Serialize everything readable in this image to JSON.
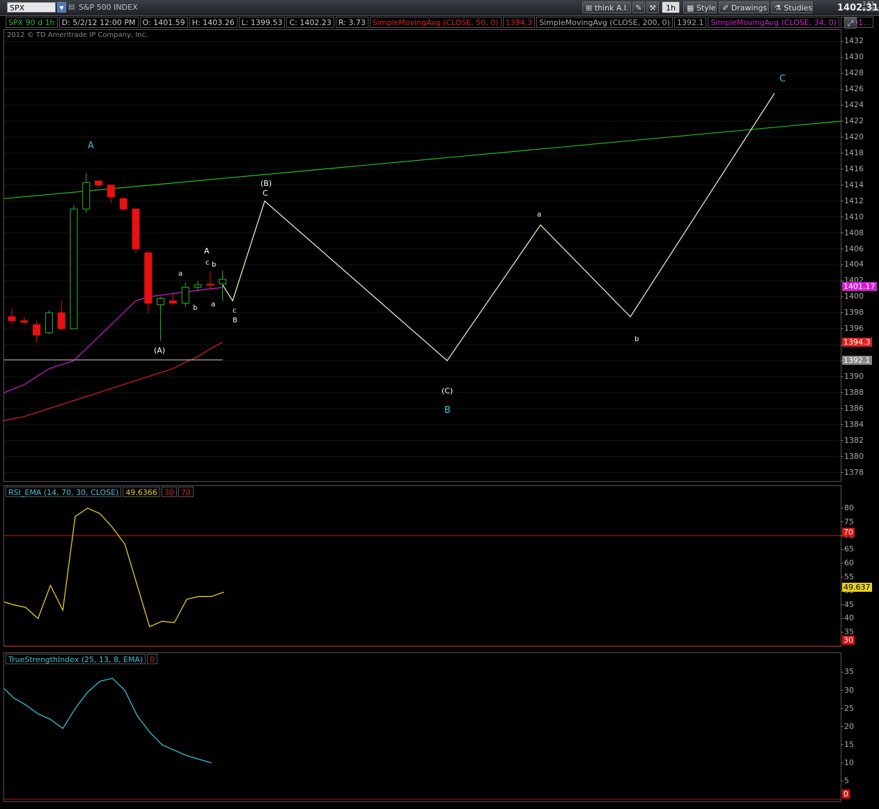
{
  "toolbar": {
    "symbol": "SPX",
    "symbol_name": "S&P 500 INDEX",
    "think_label": "think A.I.",
    "interval": "1h",
    "style_label": "Style",
    "drawings_label": "Drawings",
    "studies_label": "Studies",
    "last_price": "1402.31",
    "change": "-3.51",
    "change_pct": "-0.25%"
  },
  "header": {
    "chart_id": "SPX 90 d 1h",
    "date": "D: 5/2/12 12:00 PM",
    "open": "O: 1401.59",
    "high": "H: 1403.26",
    "low": "L: 1399.53",
    "close": "C: 1402.23",
    "range": "R: 3.73",
    "sma50_label": "SimpleMovingAvg (CLOSE, 50, 0)",
    "sma50_value": "1394.3",
    "sma200_label": "SimpleMovingAvg (CLOSE, 200, 0)",
    "sma200_value": "1392.1",
    "sma34_label": "SimpleMovingAvg (CLOSE, 34, 0)",
    "sma34_value": "1401..."
  },
  "copyright": "2012 © TD Ameritrade IP Company, Inc.",
  "price_axis": [
    "1432",
    "1430",
    "1428",
    "1426",
    "1424",
    "1422",
    "1420",
    "1418",
    "1416",
    "1414",
    "1412",
    "1410",
    "1408",
    "1406",
    "1404",
    "1402",
    "1400",
    "1398",
    "1396",
    "1394",
    "1392",
    "1390",
    "1388",
    "1386",
    "1384",
    "1382",
    "1380",
    "1378"
  ],
  "price_tags": {
    "sma34": "1401.17",
    "sma50": "1394.3",
    "sma200": "1392.1"
  },
  "rsi": {
    "label": "RSI_EMA (14, 70, 30, CLOSE)",
    "value": "49.6366",
    "os": "30",
    "ob": "70",
    "axis": [
      "80",
      "75",
      "70",
      "65",
      "60",
      "55",
      "50",
      "45",
      "40",
      "35"
    ],
    "tag_value": "49.637",
    "tag_ob": "70",
    "tag_os": "30"
  },
  "tsi": {
    "label": "TrueStrengthIndex (25, 13, 8, EMA)",
    "value": "0",
    "axis": [
      "35",
      "30",
      "25",
      "20",
      "15",
      "10",
      "5"
    ],
    "tag_zero": "0"
  },
  "wave_labels": {
    "A_big": "A",
    "B_big": "B",
    "C_big": "C",
    "A_small": "A",
    "paren_A": "(A)",
    "paren_B": "(B)",
    "paren_C": "(C)",
    "C_at_B": "C",
    "a1": "a",
    "b1": "b",
    "c1": "c",
    "b2": "b",
    "a2": "a",
    "c2": "c",
    "B2": "B",
    "a_proj": "a",
    "b_proj": "b"
  },
  "colors": {
    "up": "#2fb82f",
    "down": "#e81010",
    "sma34": "#d020d0",
    "sma50": "#e02020",
    "sma200": "#a0a0a0",
    "trendline": "#22c022",
    "projection": "#e8ecc0",
    "rsi": "#e8d020",
    "tsi": "#30c8d8",
    "cyan_label": "#3fc4d8"
  },
  "chart_data": [
    {
      "type": "candlestick",
      "title": "SPX 90 d 1h",
      "ylim": [
        1377,
        1433
      ],
      "candles": [
        {
          "o": 1397.5,
          "h": 1398.5,
          "l": 1396.5,
          "c": 1397
        },
        {
          "o": 1397,
          "h": 1397.5,
          "l": 1396.5,
          "c": 1396.8
        },
        {
          "o": 1396.5,
          "h": 1397,
          "l": 1394.2,
          "c": 1395.2
        },
        {
          "o": 1395.5,
          "h": 1398.3,
          "l": 1395.3,
          "c": 1398
        },
        {
          "o": 1398,
          "h": 1399.5,
          "l": 1395.8,
          "c": 1396
        },
        {
          "o": 1396,
          "h": 1411.5,
          "l": 1396,
          "c": 1411
        },
        {
          "o": 1411,
          "h": 1415.5,
          "l": 1410.5,
          "c": 1414.3
        },
        {
          "o": 1414.5,
          "h": 1414.5,
          "l": 1413.8,
          "c": 1414
        },
        {
          "o": 1414,
          "h": 1414,
          "l": 1411.8,
          "c": 1412.5
        },
        {
          "o": 1412.3,
          "h": 1412.5,
          "l": 1410.8,
          "c": 1411
        },
        {
          "o": 1411,
          "h": 1411.2,
          "l": 1405.5,
          "c": 1406
        },
        {
          "o": 1405.5,
          "h": 1405.8,
          "l": 1398,
          "c": 1399.2
        },
        {
          "o": 1399,
          "h": 1400,
          "l": 1394.5,
          "c": 1399.8
        },
        {
          "o": 1399.5,
          "h": 1400.3,
          "l": 1399,
          "c": 1399.2
        },
        {
          "o": 1399.2,
          "h": 1401.8,
          "l": 1398.7,
          "c": 1401.2
        },
        {
          "o": 1401.2,
          "h": 1402,
          "l": 1400.8,
          "c": 1401.5
        },
        {
          "o": 1401.6,
          "h": 1403.2,
          "l": 1401,
          "c": 1401.5
        },
        {
          "o": 1401.6,
          "h": 1403.3,
          "l": 1399.5,
          "c": 1402.2
        }
      ],
      "sma34": [
        1388,
        1389,
        1390,
        1391,
        1391.5,
        1392,
        1393.5,
        1395,
        1396.5,
        1398,
        1399.5,
        1400,
        1400.2,
        1400.4,
        1400.6,
        1400.8,
        1401,
        1401.17
      ],
      "sma50": [
        1384.5,
        1385,
        1385.5,
        1386,
        1386.5,
        1387,
        1387.5,
        1388,
        1388.5,
        1389,
        1389.5,
        1390,
        1390.5,
        1391,
        1391.8,
        1392.5,
        1393.5,
        1394.3
      ],
      "sma200": [
        1392.1,
        1392.1,
        1392.1,
        1392.1,
        1392.1,
        1392.1,
        1392.1,
        1392.1,
        1392.1,
        1392.1,
        1392.1,
        1392.1,
        1392.1,
        1392.1,
        1392.1,
        1392.1,
        1392.1,
        1392.1
      ],
      "projection": [
        1399.5,
        1412,
        1392,
        1409,
        1397.5,
        1425.5
      ],
      "trendline": [
        1412.3,
        1422
      ]
    },
    {
      "type": "line",
      "title": "RSI_EMA (14, 70, 30, CLOSE)",
      "ylim": [
        30,
        83
      ],
      "values": [
        46,
        45,
        44,
        40,
        52,
        43,
        77,
        80,
        78,
        73,
        67,
        52,
        37,
        39,
        38.5,
        47,
        48,
        48,
        49.6
      ]
    },
    {
      "type": "line",
      "title": "TrueStrengthIndex (25, 13, 8, EMA)",
      "ylim": [
        0,
        37
      ],
      "values": [
        30.5,
        28,
        26,
        23.5,
        22,
        19.5,
        25,
        29.5,
        32.5,
        33.3,
        30,
        23,
        18.5,
        15,
        13.5,
        12,
        11,
        10
      ]
    }
  ]
}
